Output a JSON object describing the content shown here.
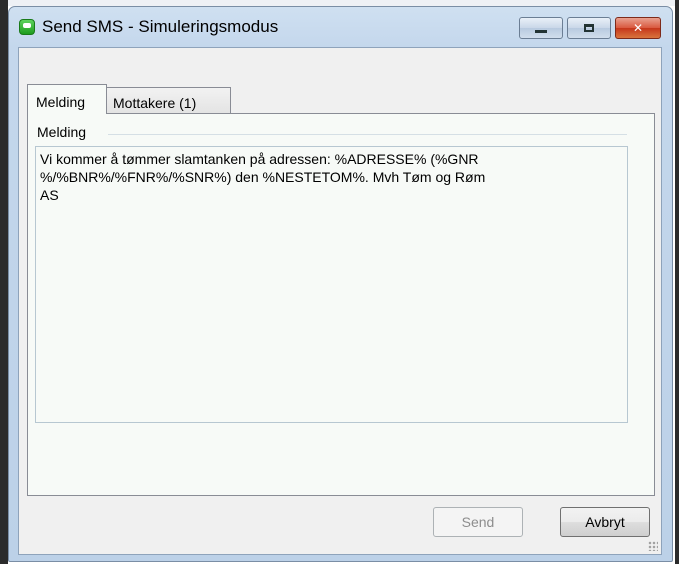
{
  "window": {
    "title": "Send SMS - Simuleringsmodus",
    "app_icon": "sms-chat-icon",
    "controls": [
      "minimize-icon",
      "maximize-icon",
      "close-icon"
    ]
  },
  "tabs": [
    {
      "label": "Melding",
      "active": true
    },
    {
      "label": "Mottakere (1)",
      "active": false
    }
  ],
  "message_group": {
    "label": "Melding",
    "text": "Vi kommer å tømmer slamtanken på adressen: %ADRESSE% (%GNR\n%/%BNR%/%FNR%/%SNR%) den %NESTETOM%. Mvh Tøm og Røm\nAS"
  },
  "buttons": {
    "send": {
      "label": "Send",
      "enabled": false
    },
    "cancel": {
      "label": "Avbryt",
      "enabled": true
    }
  },
  "colors": {
    "titlebar": "#c4d7ec",
    "close_button": "#c5361b",
    "client_background": "#f0f0f0"
  }
}
